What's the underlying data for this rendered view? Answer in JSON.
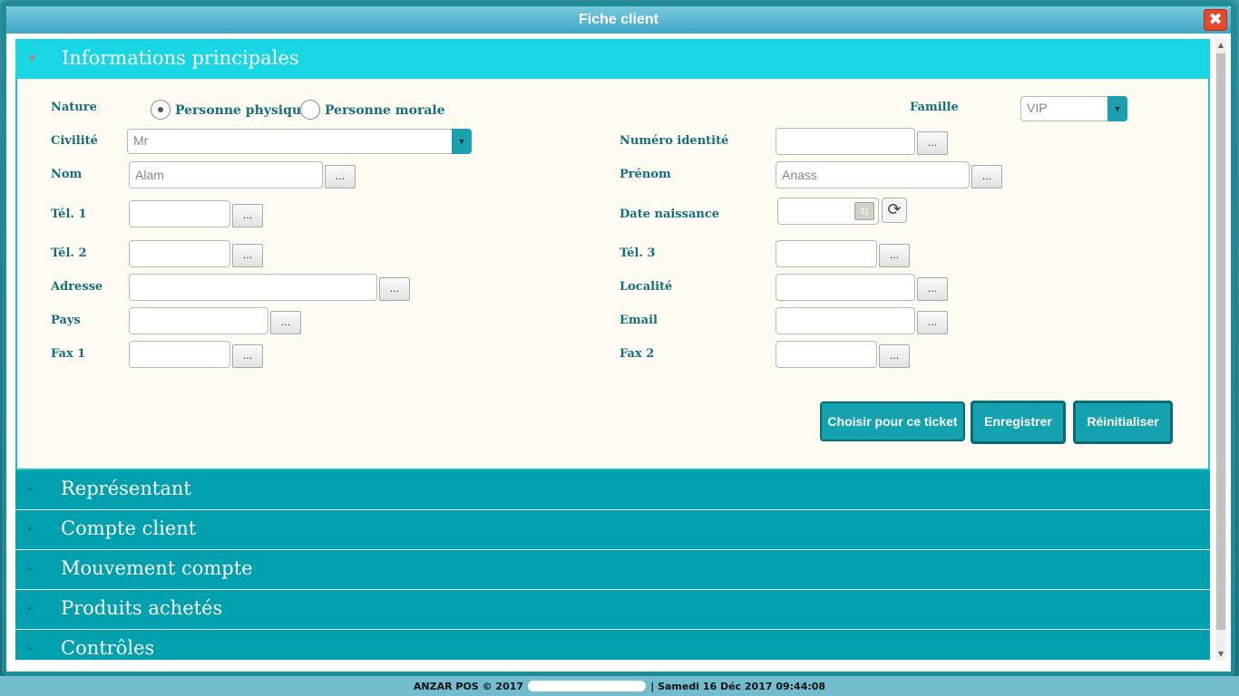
{
  "window": {
    "title": "Fiche client",
    "close_label": "✖"
  },
  "sections": [
    {
      "label": "Informations principales"
    },
    {
      "label": "Représentant"
    },
    {
      "label": "Compte client"
    },
    {
      "label": "Mouvement compte"
    },
    {
      "label": "Produits achetés"
    },
    {
      "label": "Contrôles"
    }
  ],
  "form": {
    "nature_label": "Nature",
    "nature_options": [
      "Personne physique",
      "Personne morale"
    ],
    "nature_selected": "Personne physique",
    "famille_label": "Famille",
    "famille_value": "VIP",
    "civilite_label": "Civilité",
    "civilite_value": "Mr",
    "numero_identite_label": "Numéro identité",
    "numero_identite_value": "",
    "nom_label": "Nom",
    "nom_value": "Alam",
    "prenom_label": "Prénom",
    "prenom_value": "Anass",
    "tel1_label": "Tél. 1",
    "tel1_value": "",
    "date_naissance_label": "Date naissance",
    "date_naissance_value": "",
    "calendar_day": "31",
    "tel2_label": "Tél. 2",
    "tel2_value": "",
    "tel3_label": "Tél. 3",
    "tel3_value": "",
    "adresse_label": "Adresse",
    "adresse_value": "",
    "localite_label": "Localité",
    "localite_value": "",
    "pays_label": "Pays",
    "pays_value": "",
    "email_label": "Email",
    "email_value": "",
    "fax1_label": "Fax 1",
    "fax1_value": "",
    "fax2_label": "Fax 2",
    "fax2_value": "",
    "dots_label": "..."
  },
  "buttons": {
    "choose": "Choisir pour ce ticket",
    "save": "Enregistrer",
    "reset": "Réinitialiser"
  },
  "footer": {
    "left": "ANZAR POS © 2017",
    "right": "| Samedi 16 Déc 2017 09:44:08"
  },
  "colors": {
    "accent": "#00a0ae",
    "header_open": "#19d6e5",
    "label": "#16707a",
    "close": "#e2492d"
  }
}
